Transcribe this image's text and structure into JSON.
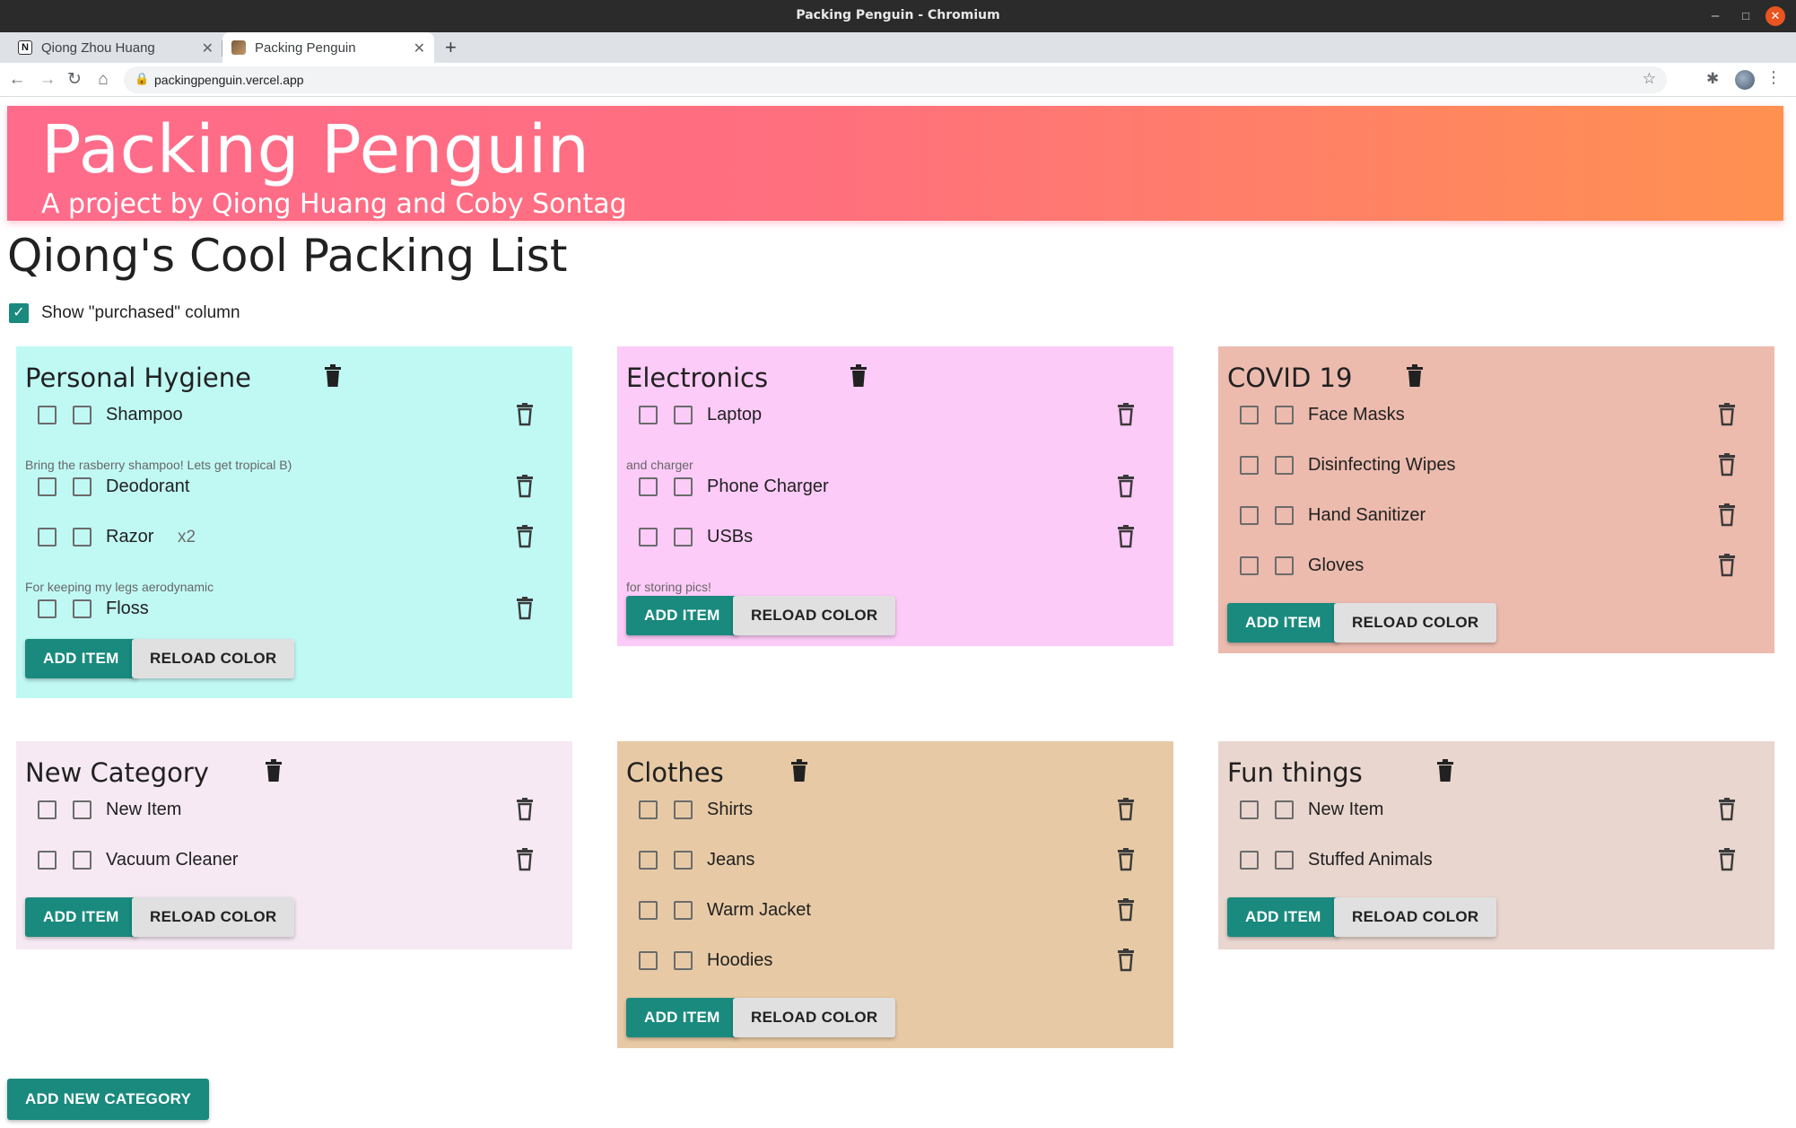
{
  "window": {
    "title": "Packing Penguin - Chromium"
  },
  "tabs": [
    {
      "label": "Qiong Zhou Huang",
      "favicon": "notion-icon",
      "active": false
    },
    {
      "label": "Packing Penguin",
      "favicon": "penguin-favicon",
      "active": true
    }
  ],
  "address_bar": {
    "url": "packingpenguin.vercel.app"
  },
  "hero": {
    "title": "Packing Penguin",
    "subtitle": "A project by Qiong Huang and Coby Sontag",
    "gradient": [
      "#ff6b8b",
      "#ff9150"
    ]
  },
  "list_title": "Qiong's Cool Packing List",
  "show_purchased": {
    "label": "Show \"purchased\" column",
    "checked": true
  },
  "buttons": {
    "add_item": "ADD ITEM",
    "reload_color": "RELOAD COLOR",
    "add_category": "ADD NEW CATEGORY"
  },
  "categories": [
    {
      "name": "Personal Hygiene",
      "color": "#c0f9f4",
      "items": [
        {
          "name": "Shampoo",
          "qty": "",
          "note": "Bring the rasberry shampoo! Lets get tropical B)"
        },
        {
          "name": "Deodorant",
          "qty": "",
          "note": ""
        },
        {
          "name": "Razor",
          "qty": "x2",
          "note": "For keeping my legs aerodynamic"
        },
        {
          "name": "Floss",
          "qty": "",
          "note": ""
        }
      ]
    },
    {
      "name": "Electronics",
      "color": "#fdcbf8",
      "items": [
        {
          "name": "Laptop",
          "qty": "",
          "note": "and charger"
        },
        {
          "name": "Phone Charger",
          "qty": "",
          "note": ""
        },
        {
          "name": "USBs",
          "qty": "",
          "note": "for storing pics!"
        }
      ]
    },
    {
      "name": "COVID 19",
      "color": "#ecbbae",
      "items": [
        {
          "name": "Face Masks",
          "qty": "",
          "note": ""
        },
        {
          "name": "Disinfecting Wipes",
          "qty": "",
          "note": ""
        },
        {
          "name": "Hand Sanitizer",
          "qty": "",
          "note": ""
        },
        {
          "name": "Gloves",
          "qty": "",
          "note": ""
        }
      ]
    },
    {
      "name": "New Category",
      "color": "#f6e9f3",
      "items": [
        {
          "name": "New Item",
          "qty": "",
          "note": ""
        },
        {
          "name": "Vacuum Cleaner",
          "qty": "",
          "note": ""
        }
      ]
    },
    {
      "name": "Clothes",
      "color": "#e7caa5",
      "items": [
        {
          "name": "Shirts",
          "qty": "",
          "note": ""
        },
        {
          "name": "Jeans",
          "qty": "",
          "note": ""
        },
        {
          "name": "Warm Jacket",
          "qty": "",
          "note": ""
        },
        {
          "name": "Hoodies",
          "qty": "",
          "note": ""
        }
      ]
    },
    {
      "name": "Fun things",
      "color": "#e9d6cf",
      "items": [
        {
          "name": "New Item",
          "qty": "",
          "note": ""
        },
        {
          "name": "Stuffed Animals",
          "qty": "",
          "note": ""
        }
      ]
    }
  ]
}
